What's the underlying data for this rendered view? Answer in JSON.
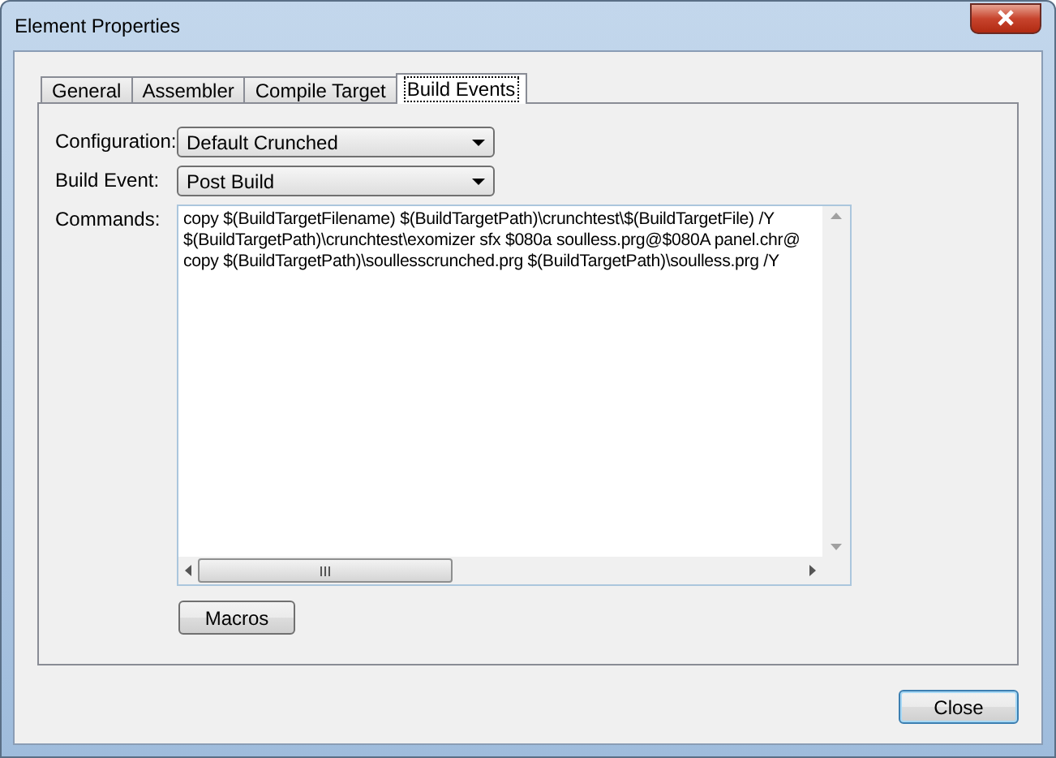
{
  "window": {
    "title": "Element Properties"
  },
  "tabs": [
    {
      "label": "General",
      "selected": false
    },
    {
      "label": "Assembler",
      "selected": false
    },
    {
      "label": "Compile Target",
      "selected": false
    },
    {
      "label": "Build Events",
      "selected": true
    }
  ],
  "configuration": {
    "label": "Configuration:",
    "value": "Default Crunched"
  },
  "build_event": {
    "label": "Build Event:",
    "value": "Post Build"
  },
  "commands": {
    "label": "Commands:",
    "lines": [
      "copy $(BuildTargetFilename) $(BuildTargetPath)\\crunchtest\\$(BuildTargetFile) /Y",
      "$(BuildTargetPath)\\crunchtest\\exomizer sfx $080a soulless.prg@$080A panel.chr@",
      "copy $(BuildTargetPath)\\soullesscrunched.prg $(BuildTargetPath)\\soulless.prg /Y"
    ]
  },
  "buttons": {
    "macros": "Macros",
    "close": "Close"
  }
}
